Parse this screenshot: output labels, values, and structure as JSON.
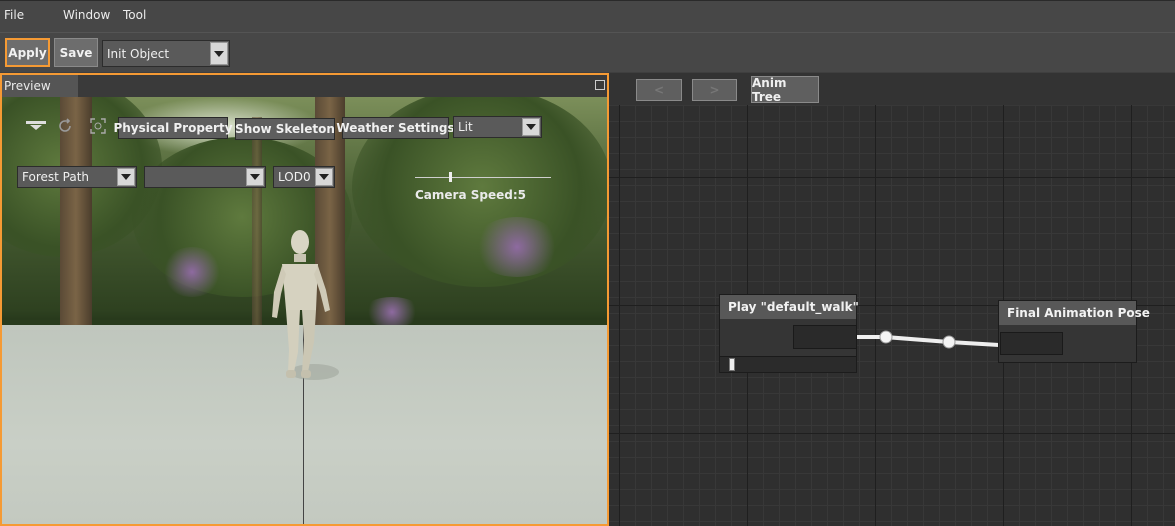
{
  "menu": {
    "items": [
      "File",
      "Window",
      "Tool"
    ]
  },
  "toolbar": {
    "apply_label": "Apply",
    "save_label": "Save",
    "object_select": "Init Object"
  },
  "preview": {
    "tab_label": "Preview",
    "buttons": {
      "physical_property": "Physical Property",
      "show_skeleton": "Show Skeleton",
      "weather_settings": "Weather Settings"
    },
    "lighting_mode": "Lit",
    "environment": "Forest Path",
    "secondary_select": "",
    "lod": "LOD0",
    "camera_speed_text": "Camera Speed:5",
    "camera_speed_level": 0.25
  },
  "graph": {
    "back_label": "<",
    "forward_label": ">",
    "anim_tree_label": "Anim Tree",
    "nodes": {
      "play": {
        "title": "Play \"default_walk\""
      },
      "final": {
        "title": "Final Animation Pose"
      }
    }
  },
  "colors": {
    "accent": "#f59a34",
    "panel": "#474747",
    "graph_bg": "#2f2f2f"
  }
}
